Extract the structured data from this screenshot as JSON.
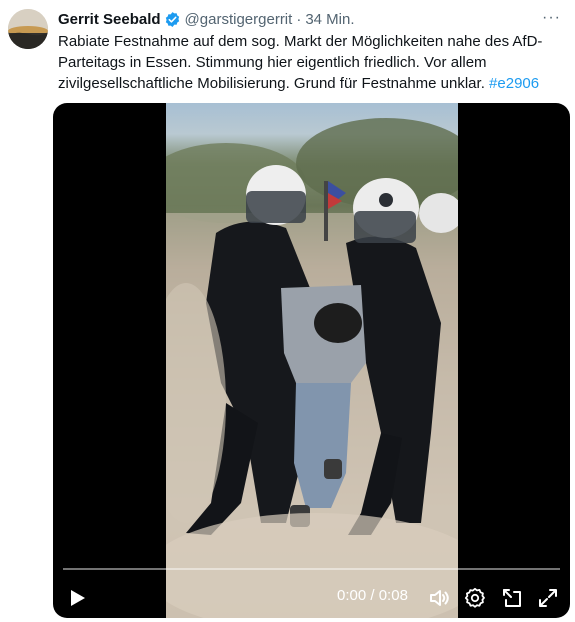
{
  "tweet": {
    "author_name": "Gerrit Seebald",
    "handle": "@garstigergerrit",
    "separator": "·",
    "time": "34 Min.",
    "more_label": "···",
    "text": "Rabiate Festnahme auf dem sog. Markt der Möglichkeiten nahe des AfD-Parteitags in Essen. Stimmung hier eigentlich friedlich. Vor allem zivilgesellschaftliche Mobilisierung. Grund für Festnahme unklar.",
    "hashtag": "#e2906",
    "verified_color": "#1d9bf0",
    "hashtag_color": "#1d9bf0"
  },
  "video": {
    "current_time": "0:00",
    "time_separator": " / ",
    "duration": "0:08",
    "progress_fraction": 0,
    "icons": [
      "play-icon",
      "volume-icon",
      "settings-icon",
      "picture-in-picture-icon",
      "fullscreen-icon"
    ]
  }
}
